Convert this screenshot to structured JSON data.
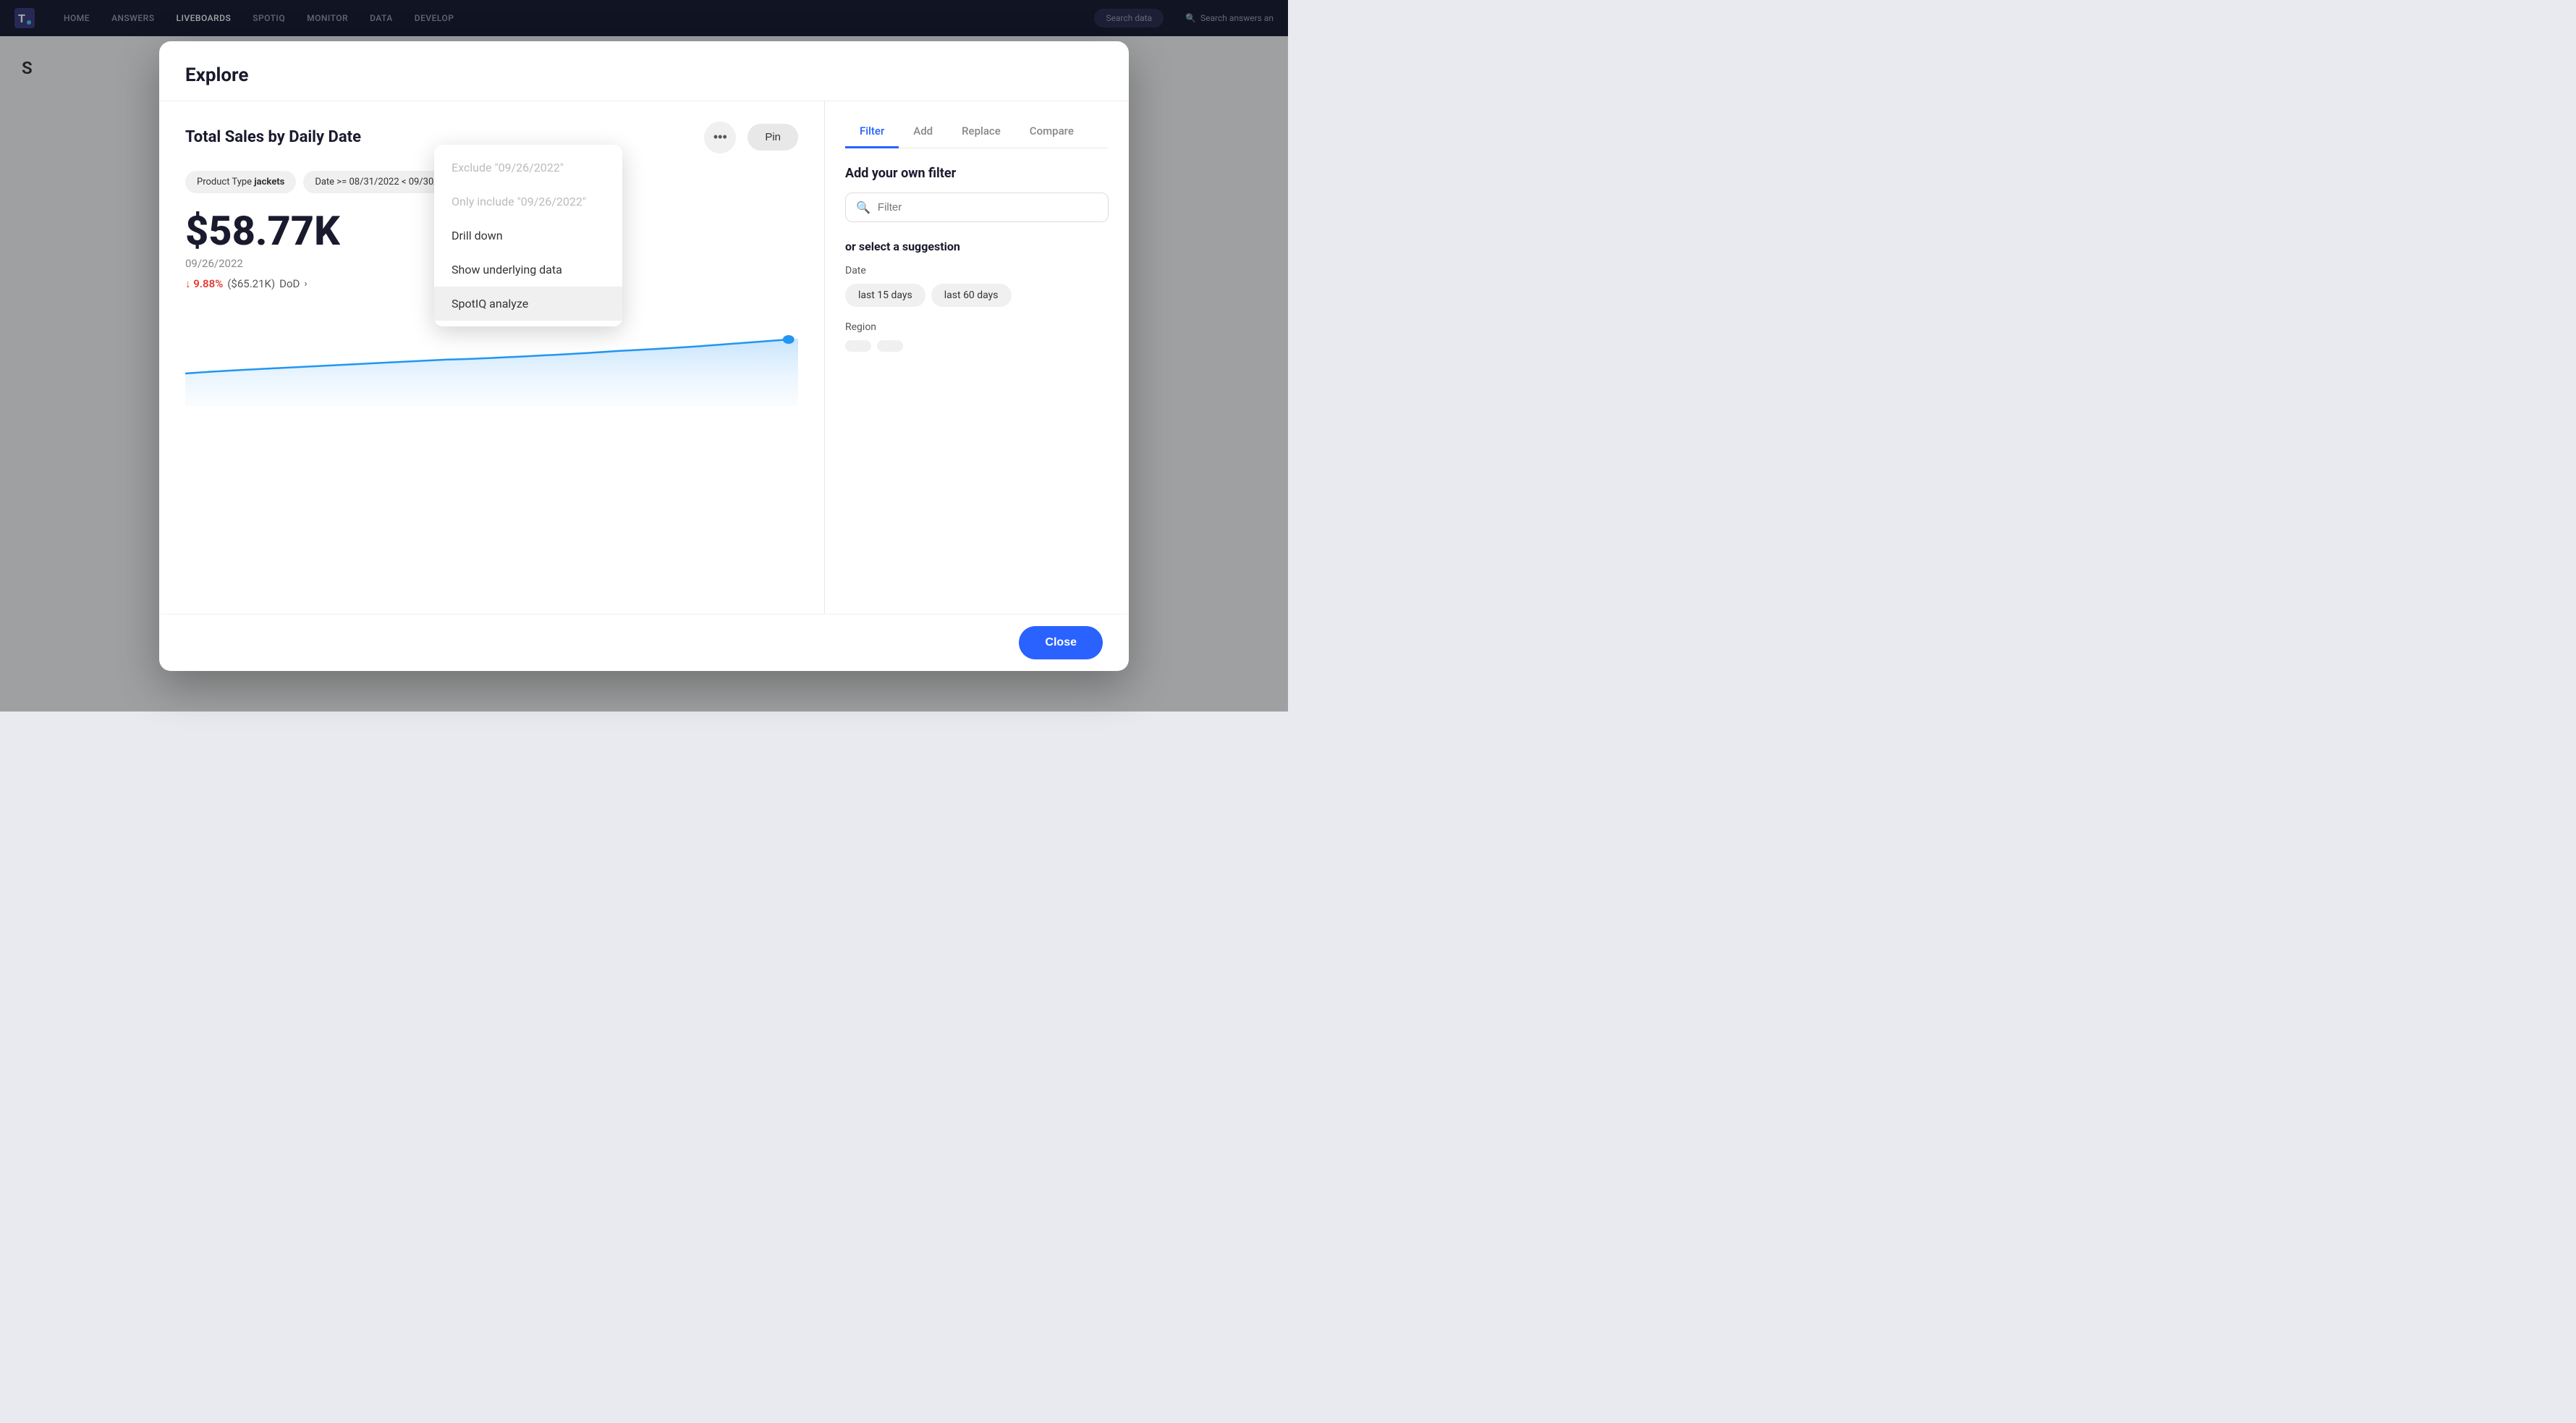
{
  "nav": {
    "logo_label": "T",
    "items": [
      {
        "label": "HOME",
        "active": false
      },
      {
        "label": "ANSWERS",
        "active": false
      },
      {
        "label": "LIVEBOARDS",
        "active": true
      },
      {
        "label": "SPOTIQ",
        "active": false
      },
      {
        "label": "MONITOR",
        "active": false
      },
      {
        "label": "DATA",
        "active": false
      },
      {
        "label": "DEVELOP",
        "active": false
      }
    ],
    "search_data_placeholder": "Search data",
    "search_answers_placeholder": "Search answers an"
  },
  "modal": {
    "title": "Explore",
    "chart": {
      "title": "Total Sales by Daily Date",
      "btn_more_label": "•••",
      "btn_pin_label": "Pin",
      "filters": [
        {
          "label": "Product Type ",
          "bold": "jackets"
        },
        {
          "label": "Date >= 08/31/2022 < 09/30/202"
        }
      ],
      "kpi_value": "$58.77K",
      "kpi_date": "09/26/2022",
      "kpi_change_pct": "↓ 9.88%",
      "kpi_change_amount": "($65.21K)",
      "kpi_change_label": "DoD",
      "kpi_chevron": "›"
    },
    "context_menu": {
      "items": [
        {
          "label": "Exclude \"09/26/2022\"",
          "disabled": true
        },
        {
          "label": "Only include \"09/26/2022\"",
          "disabled": true
        },
        {
          "label": "Drill down",
          "disabled": false
        },
        {
          "label": "Show underlying data",
          "disabled": false
        },
        {
          "label": "SpotIQ analyze",
          "disabled": false,
          "active": true
        }
      ]
    },
    "right_panel": {
      "tabs": [
        "Filter",
        "Add",
        "Replace",
        "Compare"
      ],
      "active_tab": "Filter",
      "filter_section_title": "Add your own filter",
      "filter_placeholder": "Filter",
      "suggestion_title": "or select a suggestion",
      "suggestions": [
        {
          "group": "Date",
          "chips": [
            "last 15 days",
            "last 60 days"
          ]
        },
        {
          "group": "Region",
          "chips": []
        }
      ]
    },
    "close_label": "Close"
  }
}
